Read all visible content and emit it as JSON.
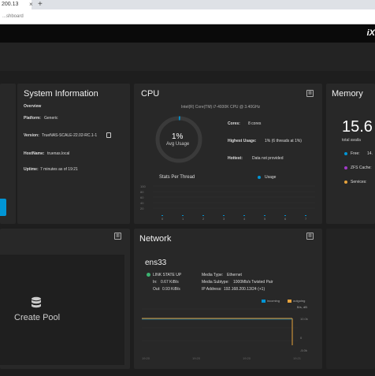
{
  "browser": {
    "tab_title": "200.13",
    "new_tab": "+",
    "close": "×",
    "address": "...shboard"
  },
  "header": {
    "logo": "iX"
  },
  "system_info": {
    "title": "System Information",
    "overview": "Overview",
    "platform_label": "Platform:",
    "platform_value": "Generic",
    "version_label": "Version:",
    "version_value": "TrueNAS-SCALE-22.02-RC.1-1",
    "hostname_label": "HostName:",
    "hostname_value": "truenas.local",
    "uptime_label": "Uptime:",
    "uptime_value": "7 minutes as of 19:21"
  },
  "cpu": {
    "title": "CPU",
    "model": "Intel(R) Core(TM) i7-4930K CPU @ 3.40GHz",
    "usage_value": "1%",
    "usage_label": "Avg Usage",
    "usage_fraction": 0.01,
    "cores_label": "Cores:",
    "cores_value": "8 cores",
    "highest_label": "Highest Usage:",
    "highest_value": "1%  (6 threads at 1%)",
    "hottest_label": "Hottest:",
    "hottest_value": "Data not provided",
    "stats_label": "Stats Per Thread",
    "legend_usage": "Usage",
    "threads": [
      "0",
      "1",
      "2",
      "3",
      "4",
      "5",
      "6",
      "7"
    ],
    "yticks": [
      "100",
      "80",
      "60",
      "40",
      "20"
    ]
  },
  "memory": {
    "title": "Memory",
    "value": "15.6",
    "sub": "total availa",
    "free_label": "Free:",
    "free_value": "14.",
    "zfs_label": "ZFS Cache:",
    "services_label": "Services:"
  },
  "pool": {
    "create_label": "Create Pool"
  },
  "network": {
    "title": "Network",
    "iface": "ens33",
    "link_state": "LINK STATE UP",
    "in_label": "In:",
    "in_value": "0.67 KiB/s",
    "out_label": "Out:",
    "out_value": "0.93 KiB/s",
    "media_type_label": "Media Type:",
    "media_type_value": "Ethernet",
    "media_sub_label": "Media Subtype:",
    "media_sub_value": "1000Mb/s Twisted Pair",
    "ip_label": "IP Address:",
    "ip_value": "192.168.200.13/24 (+1)",
    "legend_in": "incoming",
    "legend_out": "outgoing",
    "legend_unit": "B/s, dB",
    "yticks": [
      "10.0k",
      "0",
      "-5.0k"
    ],
    "xticks": [
      "19:20",
      "19:20",
      "19:20",
      "19:21"
    ]
  },
  "colors": {
    "accent": "#0095d5",
    "orange": "#e6a23c",
    "purple": "#a13ac8",
    "green": "#3cb371"
  }
}
